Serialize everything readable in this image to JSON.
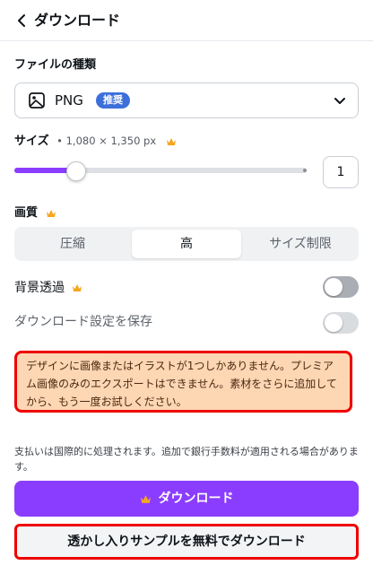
{
  "header": {
    "title": "ダウンロード",
    "back_icon": "chevron-left-icon"
  },
  "file_type": {
    "label": "ファイルの種類",
    "value": "PNG",
    "badge": "推奨",
    "icon": "image-icon"
  },
  "size": {
    "label": "サイズ",
    "dimensions": "• 1,080 × 1,350 px",
    "multiplier": "1",
    "slider_fraction": 0.2
  },
  "quality": {
    "label": "画質",
    "options": [
      "圧縮",
      "高",
      "サイズ制限"
    ],
    "selected": "高"
  },
  "transparent_bg": {
    "label": "背景透過",
    "on": false
  },
  "save_settings": {
    "label": "ダウンロード設定を保存",
    "on": false
  },
  "warning": "デザインに画像またはイラストが1つしかありません。プレミアム画像のみのエクスポートはできません。素材をさらに追加してから、もう一度お試しください。",
  "info": "支払いは国際的に処理されます。追加で銀行手数料が適用される場合があります。",
  "buttons": {
    "download": "ダウンロード",
    "watermark_download": "透かし入りサンプルを無料でダウンロード"
  },
  "colors": {
    "accent": "#8b3dff",
    "crown": "#f5a623",
    "badge": "#3d6fdb",
    "warning_bg": "#fdd6b4",
    "highlight": "#e00000"
  }
}
